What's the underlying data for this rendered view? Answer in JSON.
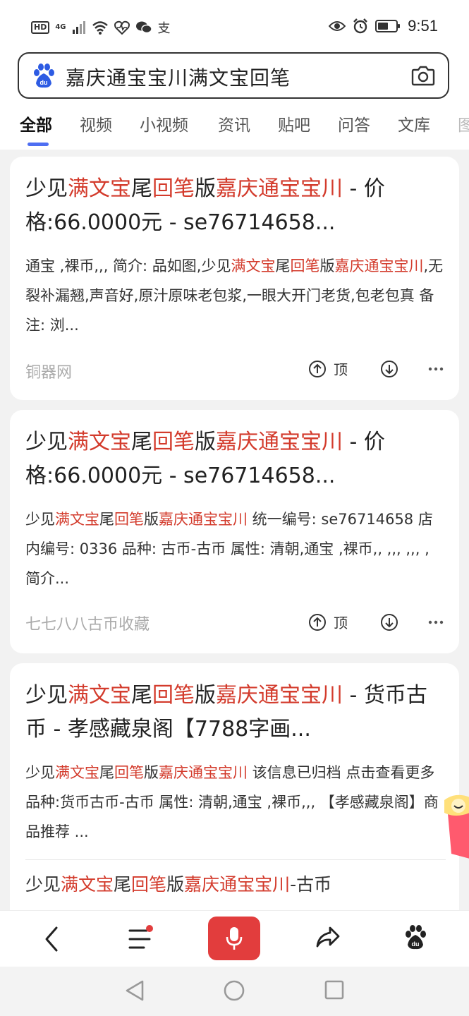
{
  "status_bar": {
    "hd": "HD",
    "network": "4G",
    "pay_icon_glyph": "支",
    "time": "9:51"
  },
  "search": {
    "query": "嘉庆通宝宝川满文宝回笔"
  },
  "tabs": [
    "全部",
    "视频",
    "小视频",
    "资讯",
    "贴吧",
    "问答",
    "文库",
    "图"
  ],
  "results": [
    {
      "title": [
        {
          "t": "少见",
          "h": false
        },
        {
          "t": "满文宝",
          "h": true
        },
        {
          "t": "尾",
          "h": false
        },
        {
          "t": "回笔",
          "h": true
        },
        {
          "t": "版",
          "h": false
        },
        {
          "t": "嘉庆通宝宝川",
          "h": true
        },
        {
          "t": " - 价格:66.0000元 - se76714658...",
          "h": false
        }
      ],
      "body": [
        {
          "t": "通宝 ,裸币,,, 简介: 品如图,少见",
          "h": false
        },
        {
          "t": "满文宝",
          "h": true
        },
        {
          "t": "尾",
          "h": false
        },
        {
          "t": "回笔",
          "h": true
        },
        {
          "t": "版",
          "h": false
        },
        {
          "t": "嘉庆通宝宝川",
          "h": true
        },
        {
          "t": ",无裂补漏翘,声音好,原汁原味老包浆,一眼大开门老货,包老包真 备注: 浏...",
          "h": false
        }
      ],
      "source": "铜器网",
      "top_label": "顶"
    },
    {
      "title": [
        {
          "t": "少见",
          "h": false
        },
        {
          "t": "满文宝",
          "h": true
        },
        {
          "t": "尾",
          "h": false
        },
        {
          "t": "回笔",
          "h": true
        },
        {
          "t": "版",
          "h": false
        },
        {
          "t": "嘉庆通宝宝川",
          "h": true
        },
        {
          "t": " - 价格:66.0000元 - se76714658...",
          "h": false
        }
      ],
      "body": [
        {
          "t": "少见",
          "h": false
        },
        {
          "t": "满文宝",
          "h": true
        },
        {
          "t": "尾",
          "h": false
        },
        {
          "t": "回笔",
          "h": true
        },
        {
          "t": "版",
          "h": false
        },
        {
          "t": "嘉庆通宝宝川",
          "h": true
        },
        {
          "t": " 统一编号: se76714658 店内编号: 0336 品种: 古币-古币 属性: 清朝,通宝 ,裸币,, ,,, ,,, , 简介...",
          "h": false
        }
      ],
      "source": "七七八八古币收藏",
      "top_label": "顶"
    },
    {
      "title": [
        {
          "t": "少见",
          "h": false
        },
        {
          "t": "满文宝",
          "h": true
        },
        {
          "t": "尾",
          "h": false
        },
        {
          "t": "回笔",
          "h": true
        },
        {
          "t": "版",
          "h": false
        },
        {
          "t": "嘉庆通宝宝川",
          "h": true
        },
        {
          "t": " - 货币古币 - 孝感藏泉阁【7788字画...",
          "h": false
        }
      ],
      "body": [
        {
          "t": "少见",
          "h": false
        },
        {
          "t": "满文宝",
          "h": true
        },
        {
          "t": "尾",
          "h": false
        },
        {
          "t": "回笔",
          "h": true
        },
        {
          "t": "版",
          "h": false
        },
        {
          "t": "嘉庆通宝宝川",
          "h": true
        },
        {
          "t": " 该信息已归档 点击查看更多 品种:货币古币-古币 属性: 清朝,通宝 ,裸币,,, 【孝感藏泉阁】商品推荐 ...",
          "h": false
        }
      ],
      "sub_item": [
        {
          "t": "少见",
          "h": false
        },
        {
          "t": "满文宝",
          "h": true
        },
        {
          "t": "尾",
          "h": false
        },
        {
          "t": "回笔",
          "h": true
        },
        {
          "t": "版",
          "h": false
        },
        {
          "t": "嘉庆通宝宝川",
          "h": true
        },
        {
          "t": "-古币",
          "h": false
        }
      ]
    }
  ],
  "colors": {
    "highlight": "#d33b2c",
    "accent": "#4e6ef2",
    "mic": "#e23d3d"
  },
  "icons": {
    "status": [
      "signal-icon",
      "wifi-icon",
      "health-icon",
      "wechat-icon",
      "alipay-icon",
      "eye-icon",
      "alarm-icon",
      "battery-icon"
    ],
    "toolbar": [
      "back-icon",
      "menu-icon",
      "mic-icon",
      "share-icon",
      "baidu-home-icon"
    ],
    "nav": [
      "nav-back-icon",
      "nav-home-icon",
      "nav-recent-icon"
    ]
  }
}
